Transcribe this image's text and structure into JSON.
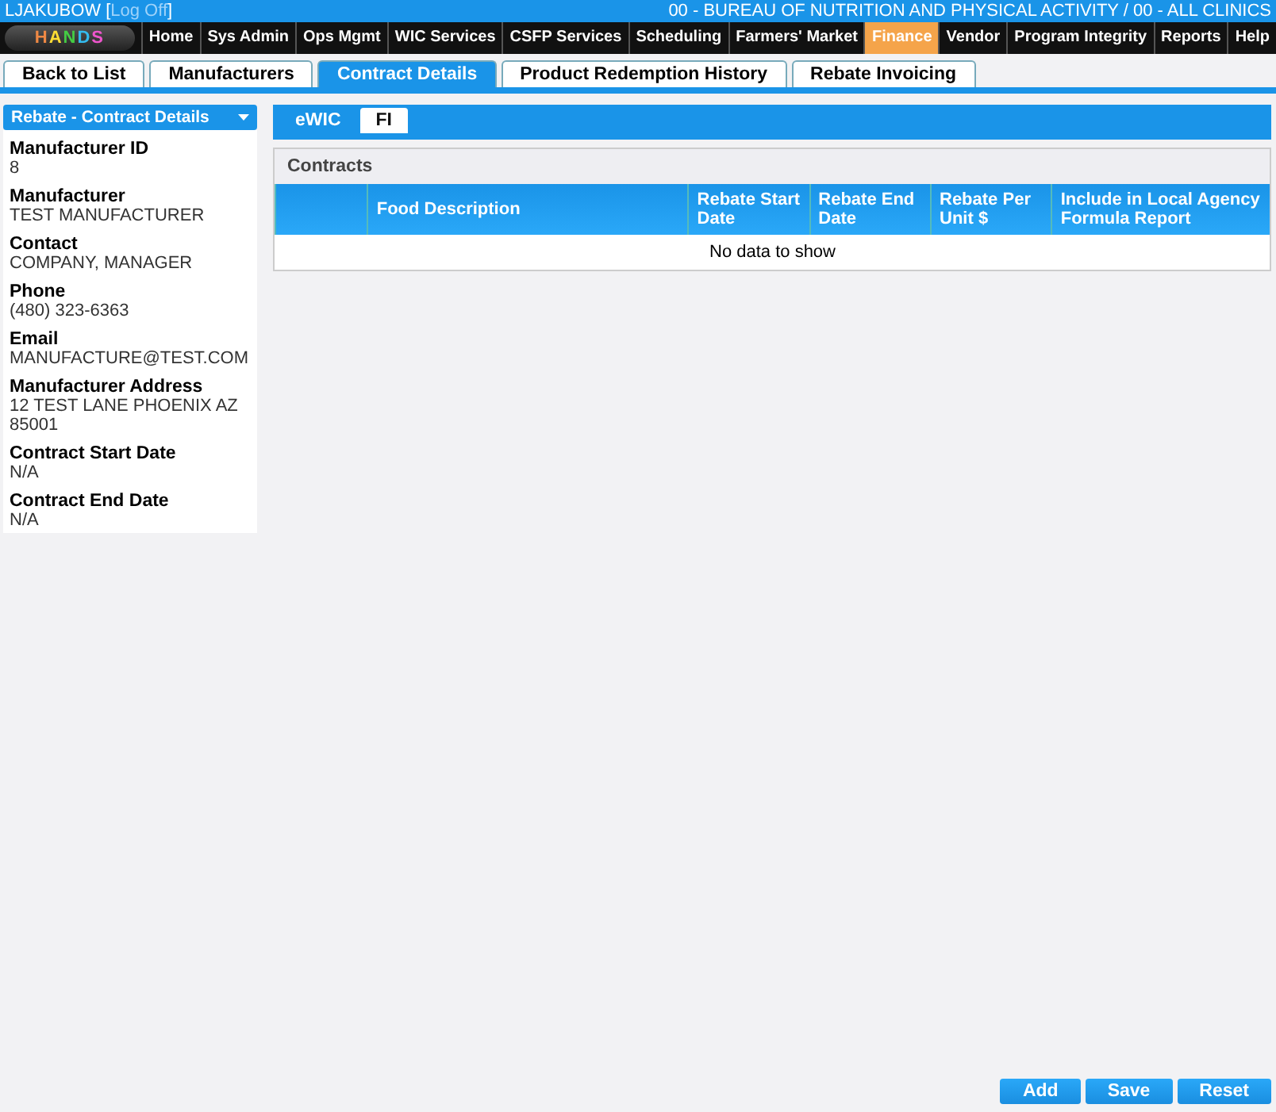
{
  "header": {
    "user": "LJAKUBOW",
    "bracket_open": "[",
    "logoff": "Log Off",
    "bracket_close": "]",
    "agency": "00 - BUREAU OF NUTRITION AND PHYSICAL ACTIVITY / 00 - ALL CLINICS"
  },
  "logo_text": "HANDS",
  "nav": [
    {
      "label": "Home",
      "selected": false
    },
    {
      "label": "Sys Admin",
      "selected": false
    },
    {
      "label": "Ops Mgmt",
      "selected": false
    },
    {
      "label": "WIC Services",
      "selected": false
    },
    {
      "label": "CSFP Services",
      "selected": false
    },
    {
      "label": "Scheduling",
      "selected": false
    },
    {
      "label": "Farmers' Market",
      "selected": false
    },
    {
      "label": "Finance",
      "selected": true
    },
    {
      "label": "Vendor",
      "selected": false
    },
    {
      "label": "Program Integrity",
      "selected": false
    },
    {
      "label": "Reports",
      "selected": false
    },
    {
      "label": "Help",
      "selected": false
    }
  ],
  "tabs": [
    {
      "label": "Back to List",
      "selected": false
    },
    {
      "label": "Manufacturers",
      "selected": false
    },
    {
      "label": "Contract Details",
      "selected": true
    },
    {
      "label": "Product Redemption History",
      "selected": false
    },
    {
      "label": "Rebate Invoicing",
      "selected": false
    }
  ],
  "sidebar": {
    "dropdown": "Rebate - Contract Details",
    "fields": [
      {
        "label": "Manufacturer ID",
        "value": "8"
      },
      {
        "label": "Manufacturer",
        "value": "TEST MANUFACTURER"
      },
      {
        "label": "Contact",
        "value": "COMPANY, MANAGER"
      },
      {
        "label": "Phone",
        "value": "(480) 323-6363"
      },
      {
        "label": "Email",
        "value": "MANUFACTURE@TEST.COM"
      },
      {
        "label": "Manufacturer Address",
        "value": "12 TEST LANE PHOENIX AZ 85001"
      },
      {
        "label": "Contract Start Date",
        "value": "N/A"
      },
      {
        "label": "Contract End Date",
        "value": "N/A"
      }
    ]
  },
  "subtabs": [
    {
      "label": "eWIC",
      "selected": true
    },
    {
      "label": "FI",
      "selected": false
    }
  ],
  "contracts": {
    "title": "Contracts",
    "columns": [
      "Food Description",
      "Rebate Start Date",
      "Rebate End Date",
      "Rebate Per Unit $",
      "Include in Local Agency Formula Report"
    ],
    "empty": "No data to show"
  },
  "buttons": [
    "Add",
    "Save",
    "Reset"
  ]
}
